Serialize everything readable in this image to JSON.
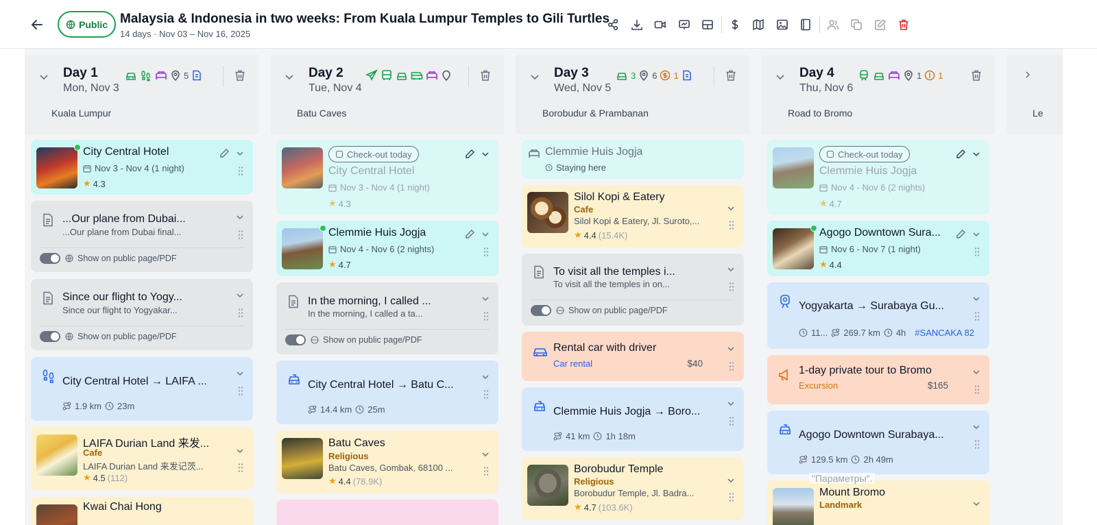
{
  "header": {
    "visibility": "Public",
    "title": "Malaysia & Indonesia in two weeks: From Kuala Lumpur Temples to Gili Turtles",
    "subtitle": "14 days · Nov 03 – Nov 16, 2025",
    "tools": [
      "share-icon",
      "download-icon",
      "video-icon",
      "presentation-icon",
      "layout-icon",
      "dollar-icon",
      "map-icon",
      "image-icon",
      "book-icon",
      "users-icon",
      "copy-icon",
      "edit-icon",
      "delete-icon"
    ]
  },
  "days": [
    {
      "name": "Day 1",
      "date": "Mon, Nov 3",
      "tag": "Kuala Lumpur",
      "places_count": "5",
      "cards": {
        "hotel": {
          "title": "City Central Hotel",
          "dates": "Nov 3 - Nov 4 (1 night)",
          "rating": "4.3"
        },
        "note1": {
          "title": "...Our plane from Dubai...",
          "excerpt": "...Our plane from Dubai final...",
          "public": "Show on public page/PDF"
        },
        "note2": {
          "title": "Since our flight to Yogy...",
          "excerpt": "Since our flight to Yogyakar...",
          "public": "Show on public page/PDF"
        },
        "walk": {
          "title": "City Central Hotel → LAIFA ...",
          "distance": "1.9 km",
          "duration": "23m"
        },
        "place1": {
          "title": "LAIFA Durian Land 来发...",
          "type": "Cafe",
          "address": "LAIFA Durian Land 来发记茨...",
          "rating": "4.5",
          "count": "(112)"
        },
        "place2": {
          "title": "Kwai Chai Hong"
        }
      }
    },
    {
      "name": "Day 2",
      "date": "Tue, Nov 4",
      "tag": "Batu Caves",
      "cards": {
        "hotelout": {
          "chip": "Check-out today",
          "title": "City Central Hotel",
          "dates": "Nov 3 - Nov 4 (1 night)",
          "rating": "4.3"
        },
        "hotel": {
          "title": "Clemmie Huis Jogja",
          "dates": "Nov 4 - Nov 6 (2 nights)",
          "rating": "4.7"
        },
        "note": {
          "title": "In the morning, I called ...",
          "excerpt": "In the morning, I called a ta...",
          "public": "Show on public page/PDF"
        },
        "taxi": {
          "title": "City Central Hotel → Batu C...",
          "distance": "14.4 km",
          "duration": "25m"
        },
        "place": {
          "title": "Batu Caves",
          "type": "Religious",
          "address": "Batu Caves, Gombak, 68100 ...",
          "rating": "4.4",
          "count": "(78.9K)"
        }
      }
    },
    {
      "name": "Day 3",
      "date": "Wed, Nov 5",
      "tag": "Borobudur & Prambanan",
      "car_count": "3",
      "places_count": "6",
      "cost_count": "1",
      "cards": {
        "stay": {
          "title": "Clemmie Huis Jogja",
          "status": "Staying here"
        },
        "cafe": {
          "title": "Silol Kopi & Eatery",
          "type": "Cafe",
          "address": "Silol Kopi & Eatery, Jl. Suroto,...",
          "rating": "4.4",
          "count": "(15.4K)"
        },
        "note": {
          "title": "To visit all the temples i...",
          "excerpt": "To visit all the temples in on...",
          "public": "Show on public page/PDF"
        },
        "rental": {
          "title": "Rental car with driver",
          "type": "Car rental",
          "price": "$40"
        },
        "drive": {
          "title": "Clemmie Huis Jogja → Boro...",
          "distance": "41 km",
          "duration": "1h 18m"
        },
        "temple": {
          "title": "Borobudur Temple",
          "type": "Religious",
          "address": "Borobudur Temple, Jl. Badra...",
          "rating": "4.7",
          "count": "(103.6K)"
        }
      }
    },
    {
      "name": "Day 4",
      "date": "Thu, Nov 6",
      "tag": "Road to Bromo",
      "places_count": "1",
      "cost_count": "1",
      "cards": {
        "hotelout": {
          "chip": "Check-out today",
          "title": "Clemmie Huis Jogja",
          "dates": "Nov 4 - Nov 6 (2 nights)",
          "rating": "4.7"
        },
        "hotel": {
          "title": "Agogo Downtown Sura...",
          "dates": "Nov 6 - Nov 7 (1 night)",
          "rating": "4.4"
        },
        "train": {
          "title": "Yogyakarta → Surabaya Gu...",
          "time": "11...",
          "distance": "269.7 km",
          "duration": "4h",
          "code": "#SANCAKA 82"
        },
        "tour": {
          "title": "1-day private tour to Bromo",
          "type": "Excursion",
          "price": "$165"
        },
        "drive": {
          "title": "Agogo Downtown Surabaya...",
          "distance": "129.5 km",
          "duration": "2h 49m"
        },
        "place": {
          "title": "Mount Bromo",
          "type": "Landmark"
        }
      }
    }
  ],
  "next_col_label": "Le",
  "caption": "\"Параметры\"."
}
